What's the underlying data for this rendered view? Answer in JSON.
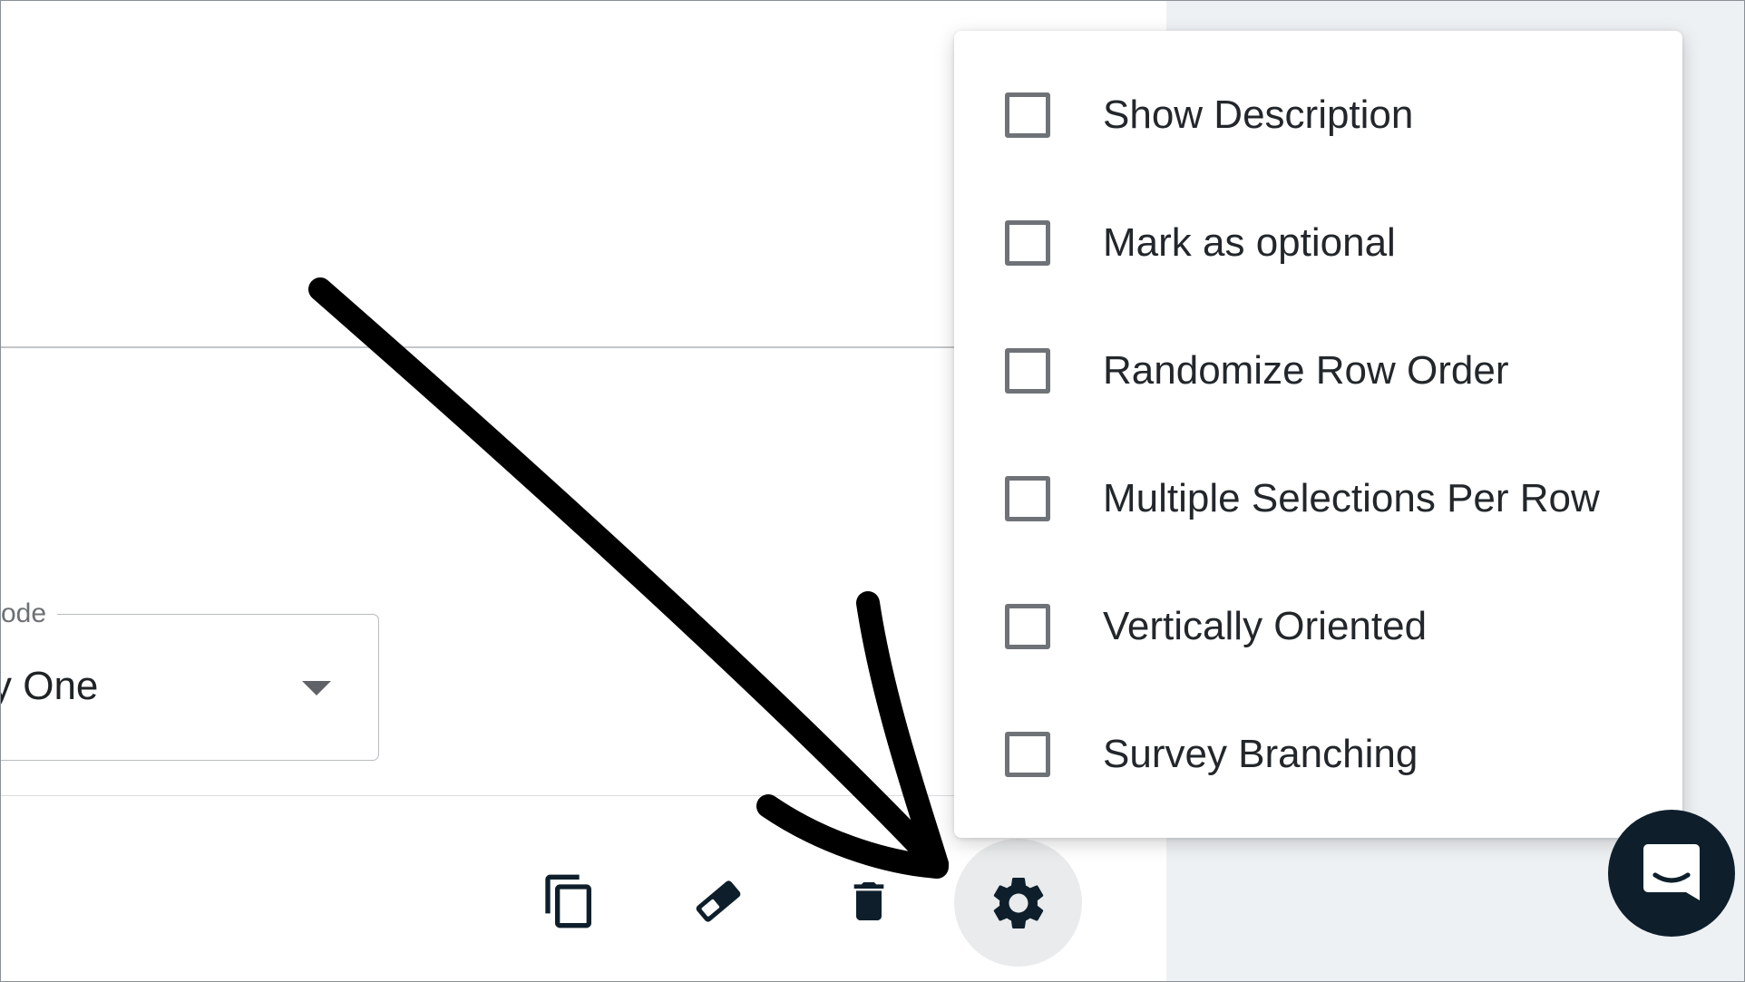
{
  "form": {
    "select_label": "ode",
    "select_value": "y One"
  },
  "toolbar": {
    "duplicate": "copy-icon",
    "clear": "eraser-icon",
    "delete": "trash-icon",
    "settings": "gear-icon"
  },
  "settings_menu": {
    "items": [
      {
        "label": "Show Description",
        "checked": false
      },
      {
        "label": "Mark as optional",
        "checked": false
      },
      {
        "label": "Randomize Row Order",
        "checked": false
      },
      {
        "label": "Multiple Selections Per Row",
        "checked": false
      },
      {
        "label": "Vertically Oriented",
        "checked": false
      },
      {
        "label": "Survey Branching",
        "checked": false
      }
    ]
  },
  "chat": {
    "icon": "chat-icon"
  },
  "colors": {
    "icon_dark": "#0e1f2b",
    "page_bg_right": "#eef1f4",
    "checkbox_border": "#6f7378",
    "annotation_arrow": "#000000"
  }
}
